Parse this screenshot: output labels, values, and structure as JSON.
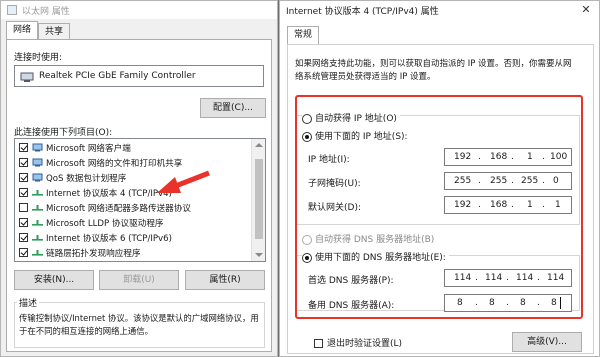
{
  "left_window": {
    "title": "以太网 属性",
    "tabs": [
      "网络",
      "共享"
    ],
    "connect_using_label": "连接时使用:",
    "adapter_name": "Realtek PCIe GbE Family Controller",
    "configure_button": "配置(C)...",
    "items_label": "此连接使用下列项目(O):",
    "items": [
      {
        "label": "Microsoft 网络客户端",
        "checked": true
      },
      {
        "label": "Microsoft 网络的文件和打印机共享",
        "checked": true
      },
      {
        "label": "QoS 数据包计划程序",
        "checked": true
      },
      {
        "label": "Internet 协议版本 4 (TCP/IPv4)",
        "checked": true
      },
      {
        "label": "Microsoft 网络适配器多路传送器协议",
        "checked": false
      },
      {
        "label": "Microsoft LLDP 协议驱动程序",
        "checked": true
      },
      {
        "label": "Internet 协议版本 6 (TCP/IPv6)",
        "checked": true
      },
      {
        "label": "链路层拓扑发现响应程序",
        "checked": true
      }
    ],
    "install_button": "安装(N)...",
    "uninstall_button": "卸载(U)",
    "properties_button": "属性(R)",
    "description_label": "描述",
    "description_text_1": "传输控制协议/Internet 协议。该协议是默认的广域网络协议，用",
    "description_text_2": "于在不同的相互连接的网络上通信。"
  },
  "right_window": {
    "title": "Internet 协议版本 4 (TCP/IPv4) 属性",
    "tab": "常规",
    "intro_1": "如果网络支持此功能，则可以获取自动指派的 IP 设置。否则，你需要从网",
    "intro_2": "络系统管理员处获得适当的 IP 设置。",
    "auto_ip_label": "自动获得 IP 地址(O)",
    "use_ip_label": "使用下面的 IP 地址(S):",
    "ip_address_label": "IP 地址(I):",
    "ip_address": [
      "192",
      "168",
      "1",
      "100"
    ],
    "subnet_label": "子网掩码(U):",
    "subnet": [
      "255",
      "255",
      "255",
      "0"
    ],
    "gateway_label": "默认网关(D):",
    "gateway": [
      "192",
      "168",
      "1",
      "1"
    ],
    "auto_dns_label": "自动获得 DNS 服务器地址(B)",
    "use_dns_label": "使用下面的 DNS 服务器地址(E):",
    "preferred_dns_label": "首选 DNS 服务器(P):",
    "preferred_dns": [
      "114",
      "114",
      "114",
      "114"
    ],
    "alternate_dns_label": "备用 DNS 服务器(A):",
    "alternate_dns": [
      "8",
      "8",
      "8",
      "8"
    ],
    "validate_label": "退出时验证设置(L)",
    "advanced_button": "高级(V)..."
  },
  "colors": {
    "highlight": "#e8322a",
    "arrow": "#e8322a"
  }
}
